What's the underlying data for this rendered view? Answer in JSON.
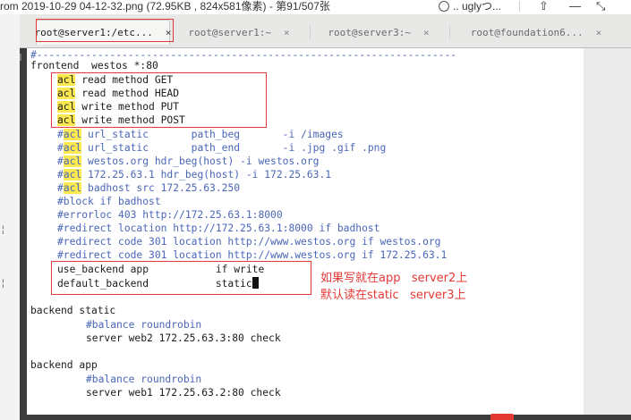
{
  "viewer": {
    "title": "rom 2019-10-29 04-12-32.png (72.95KB , 824x581像素) - 第91/507张",
    "user_label": ".. uglyつ...",
    "icons": [
      "avatar-icon",
      "pin-icon",
      "minimize-icon",
      "collapse-icon"
    ]
  },
  "tabs": [
    {
      "label": "root@server1:/etc...",
      "close": "×",
      "active": true
    },
    {
      "label": "root@server1:~",
      "close": "×",
      "active": false
    },
    {
      "label": "root@server3:~",
      "close": "×",
      "active": false
    },
    {
      "label": "root@foundation6...",
      "close": "×",
      "active": false
    }
  ],
  "terminal": {
    "separator": "#---------------------------------------------------------------------",
    "frontend": "frontend  westos *:80",
    "acl_keyword": "acl",
    "acl_lines": [
      " read method GET",
      " read method HEAD",
      " write method PUT",
      " write method POST"
    ],
    "comment_acl_prefix": "#",
    "comment_acl_lines": [
      " url_static       path_beg       -i /images",
      " url_static       path_end       -i .jpg .gif .png",
      " westos.org hdr_beg(host) -i westos.org",
      " 172.25.63.1 hdr_beg(host) -i 172.25.63.1",
      " badhost src 172.25.63.250"
    ],
    "comment_lines": [
      "#block if badhost",
      "#errorloc 403 http://172.25.63.1:8000",
      "#redirect location http://172.25.63.1:8000 if badhost",
      "#redirect code 301 location http://www.westos.org if westos.org",
      "#redirect code 301 location http://www.westos.org if 172.25.63.1"
    ],
    "use_backend": "use_backend app           if write",
    "default_backend": "default_backend           static",
    "backend_static": "backend static",
    "balance_comment_1": "#balance roundrobin",
    "server_web2": "server web2 172.25.63.3:80 check",
    "backend_app": "backend app",
    "balance_comment_2": "#balance roundrobin",
    "server_web1": "server web1 172.25.63.2:80 check"
  },
  "annotations": {
    "note1": "如果写就在app   server2上",
    "note2": "默认读在static   server3上"
  },
  "colors": {
    "annotation_red": "#e53935",
    "highlight_yellow": "#fce94f",
    "comment_blue": "#4a66b8",
    "text": "#1c1c1c"
  }
}
